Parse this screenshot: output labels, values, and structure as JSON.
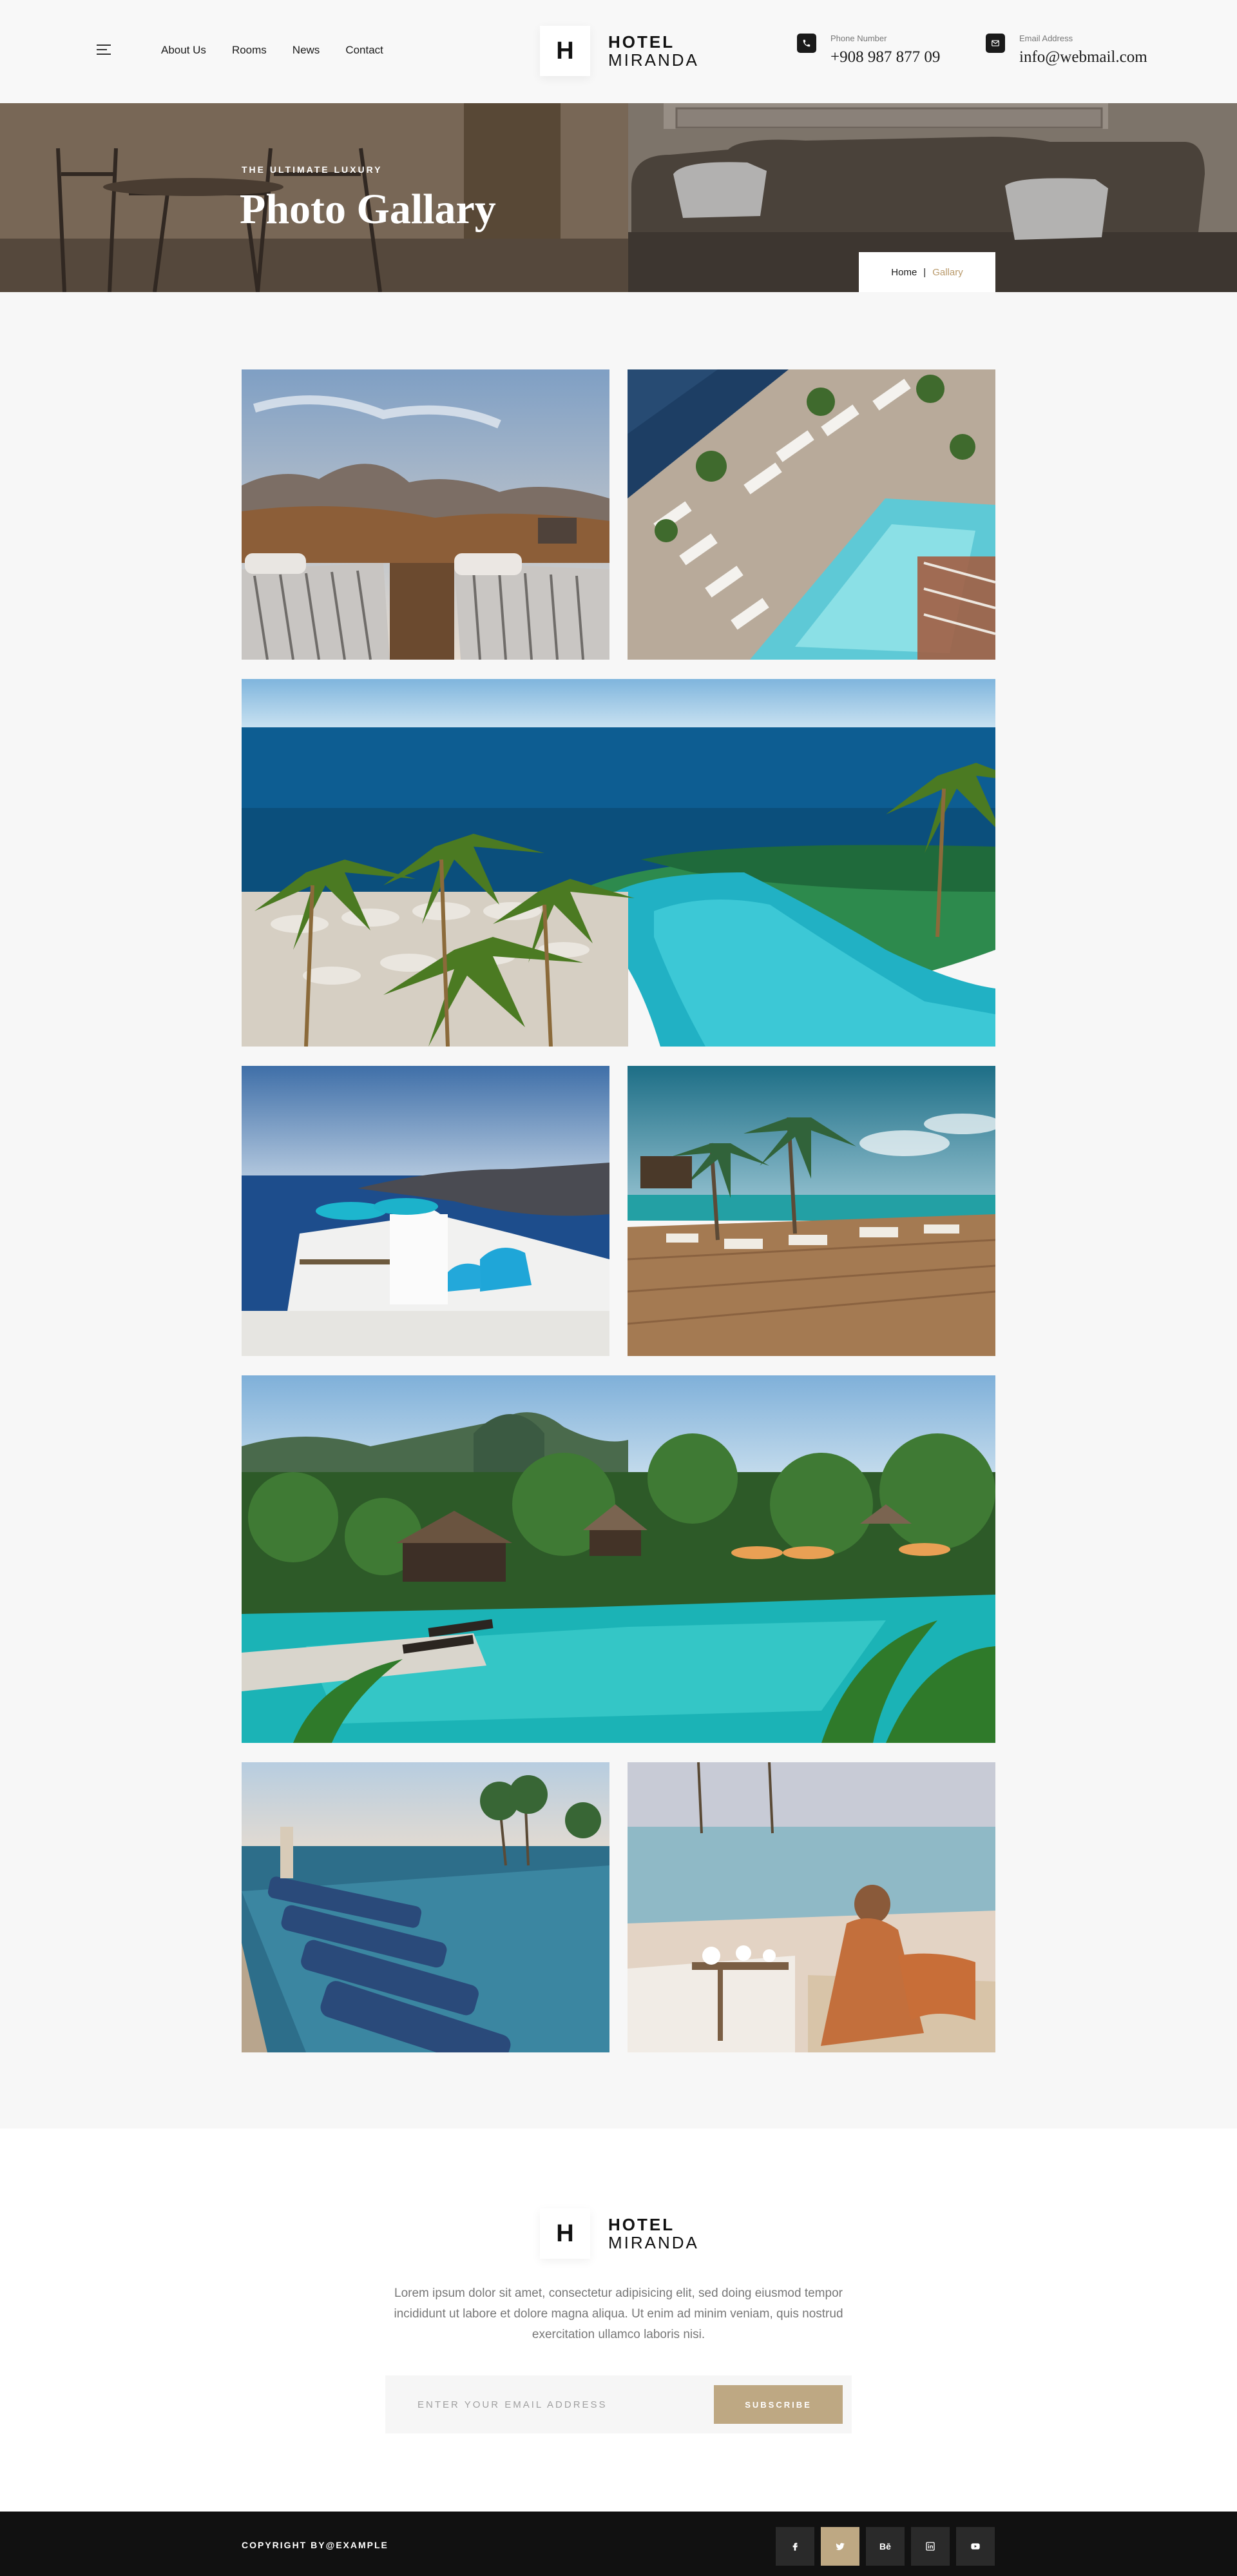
{
  "header": {
    "nav": [
      "About Us",
      "Rooms",
      "News",
      "Contact"
    ],
    "logo_letter": "H",
    "logo_line1": "HOTEL",
    "logo_line2": "MIRANDA",
    "phone_label": "Phone Number",
    "phone_value": "+908 987 877 09",
    "email_label": "Email Address",
    "email_value": "info@webmail.com"
  },
  "hero": {
    "subtitle": "THE ULTIMATE LUXURY",
    "title": "Photo Gallary",
    "breadcrumb_home": "Home",
    "breadcrumb_sep": "|",
    "breadcrumb_current": "Gallary"
  },
  "gallery": {
    "images": [
      "sunbeds-mountain-view",
      "rooftop-pool-aerial",
      "infinity-pool-ocean-palms",
      "santorini-terrace",
      "beach-deck-palms",
      "tropical-resort-pool",
      "pool-loungers-sunset",
      "poolside-woman-breakfast"
    ]
  },
  "footer": {
    "logo_letter": "H",
    "logo_line1": "HOTEL",
    "logo_line2": "MIRANDA",
    "description": "Lorem ipsum dolor sit amet, consectetur adipisicing elit, sed doing eiusmod tempor incididunt ut labore et dolore magna aliqua. Ut enim ad minim veniam, quis nostrud exercitation ullamco laboris nisi.",
    "email_placeholder": "ENTER YOUR EMAIL ADDRESS",
    "subscribe_label": "SUBSCRIBE",
    "copyright": "COPYRIGHT BY@EXAMPLE",
    "social_behance": "Bē",
    "social_icons": [
      "facebook-icon",
      "twitter-icon",
      "behance-icon",
      "linkedin-icon",
      "youtube-icon"
    ]
  },
  "colors": {
    "accent": "#bea883",
    "breadcrumb_accent": "#b99a6b",
    "dark": "#111111",
    "background": "#f7f7f7"
  }
}
